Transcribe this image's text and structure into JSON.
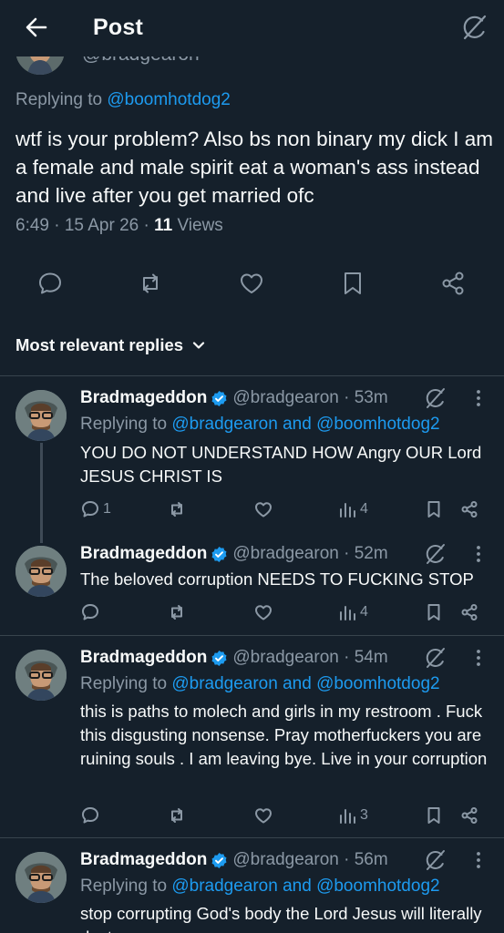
{
  "header": {
    "title": "Post"
  },
  "partial_author": {
    "handle": "@bradgearon"
  },
  "post": {
    "replying_prefix": "Replying to ",
    "replying_to": "@boomhotdog2",
    "text": "wtf is your problem? Also bs non binary my dick I am a female and male spirit eat a woman's ass instead and live after you get married ofc",
    "time": "6:49 · 15 Apr 26 · ",
    "views_count": "11",
    "views_label": " Views"
  },
  "sort": {
    "label": "Most relevant replies"
  },
  "colors": {
    "background": "#15202b",
    "accent": "#1d9bf0",
    "muted": "#8b98a5",
    "divider": "#38444d"
  },
  "replies": [
    {
      "name": "Bradmageddon",
      "handle": "@bradgearon · 53m",
      "replying_prefix": "Replying to ",
      "replying_to": "@bradgearon and @boomhotdog2",
      "text": "YOU DO NOT UNDERSTAND HOW Angry OUR Lord JESUS CHRIST IS",
      "reply_count": "1",
      "views": "4"
    },
    {
      "name": "Bradmageddon",
      "handle": "@bradgearon · 52m",
      "text": "The beloved corruption NEEDS TO FUCKING STOP",
      "reply_count": "",
      "views": "4"
    },
    {
      "name": "Bradmageddon",
      "handle": "@bradgearon · 54m",
      "replying_prefix": "Replying to ",
      "replying_to": "@bradgearon and @boomhotdog2",
      "text": "this is paths to molech and girls in my restroom . Fuck this disgusting nonsense. Pray motherfuckers you are ruining souls . I am leaving bye. Live in your corruption",
      "reply_count": "",
      "views": "3"
    },
    {
      "name": "Bradmageddon",
      "handle": "@bradgearon · 56m",
      "replying_prefix": "Replying to ",
      "replying_to": "@bradgearon and @boomhotdog2",
      "text": "stop corrupting God's body the Lord Jesus will literally destroy you"
    }
  ]
}
